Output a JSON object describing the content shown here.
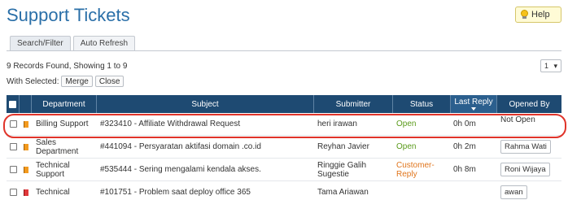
{
  "page": {
    "title": "Support Tickets"
  },
  "help": {
    "label": "Help",
    "icon": "lightbulb-icon"
  },
  "tabs": [
    {
      "label": "Search/Filter"
    },
    {
      "label": "Auto Refresh"
    }
  ],
  "records": {
    "summary": "9 Records Found, Showing 1 to 9",
    "with_selected": "With Selected:",
    "merge_label": "Merge",
    "close_label": "Close"
  },
  "pagination": {
    "current_page": "1"
  },
  "table": {
    "columns": [
      "Department",
      "Subject",
      "Submitter",
      "Status",
      "Last Reply",
      "Opened By"
    ],
    "rows": [
      {
        "department": "Billing Support",
        "subject": "#323410 - Affiliate Withdrawal Request",
        "submitter": "heri irawan",
        "status": "Open",
        "last_reply": "0h 0m",
        "opened_by": "Not Open",
        "flag": "orange"
      },
      {
        "department": "Sales Department",
        "subject": "#441094 - Persyaratan aktifasi domain .co.id",
        "submitter": "Reyhan Javier",
        "status": "Open",
        "last_reply": "0h 2m",
        "opened_by": "Rahma Wati",
        "flag": "orange"
      },
      {
        "department": "Technical Support",
        "subject": "#535444 - Sering mengalami kendala akses.",
        "submitter": "Ringgie Galih Sugestie",
        "status": "Customer-Reply",
        "last_reply": "0h 8m",
        "opened_by": "Roni Wijaya",
        "flag": "orange"
      },
      {
        "department": "Technical",
        "subject": "#101751 - Problem saat deploy office 365",
        "submitter": "Tama Ariawan",
        "status": "",
        "last_reply": "",
        "opened_by": "awan",
        "flag": "red"
      }
    ]
  },
  "colors": {
    "title": "#2a6fa8",
    "header_bg": "#1e4a72",
    "status_open": "#5a9a1a",
    "status_customer_reply": "#e0751c",
    "highlight": "#e0342a"
  }
}
